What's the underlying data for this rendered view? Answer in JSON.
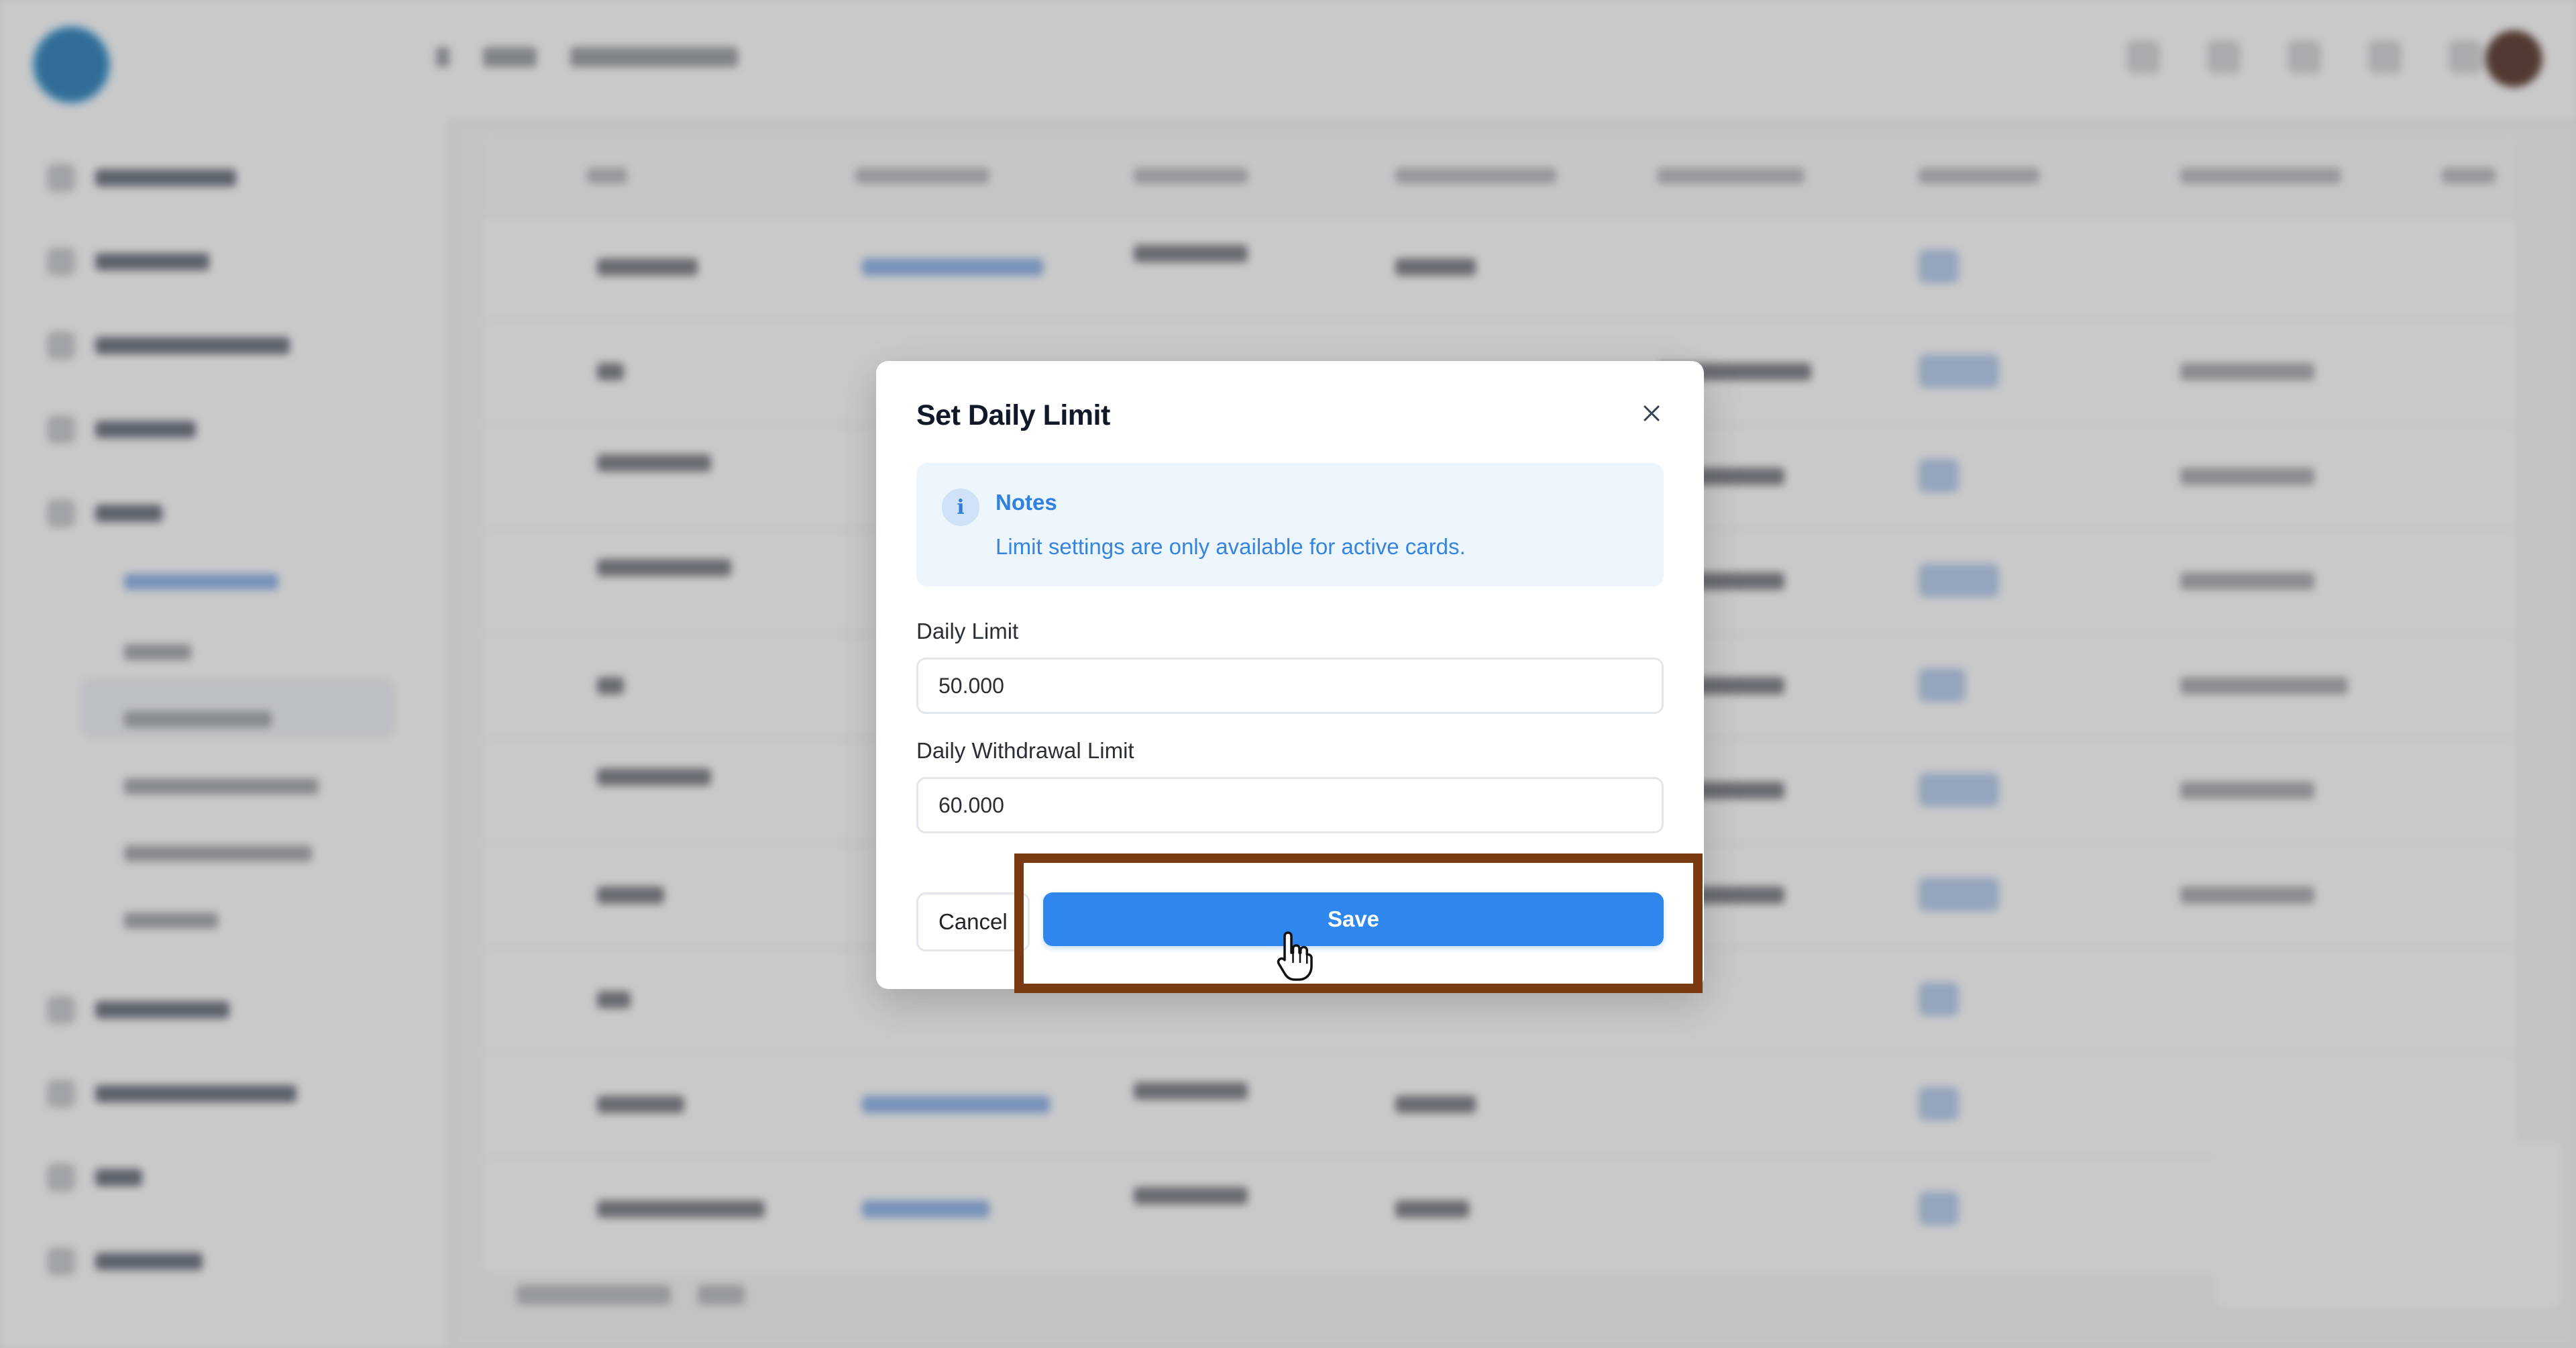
{
  "modal": {
    "title": "Set Daily Limit",
    "close_icon": "close-icon",
    "notes": {
      "icon": "info-icon",
      "title": "Notes",
      "body": "Limit settings are only available for active cards."
    },
    "daily_limit": {
      "label": "Daily Limit",
      "value": "50.000"
    },
    "daily_withdrawal_limit": {
      "label": "Daily Withdrawal Limit",
      "value": "60.000"
    },
    "cancel_label": "Cancel",
    "save_label": "Save"
  },
  "colors": {
    "primary": "#2f86ec",
    "notes_bg": "#eef6fd",
    "notes_text": "#2f80e0",
    "highlight_border": "#7b3b12"
  },
  "cursor": "hand-pointer-icon"
}
